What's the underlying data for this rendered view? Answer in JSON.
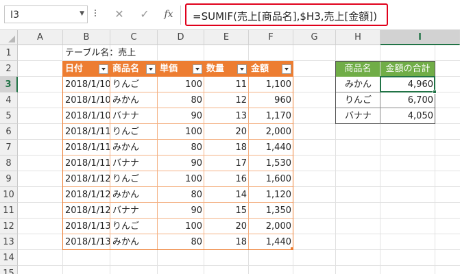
{
  "formula_bar": {
    "name_box": "I3",
    "cancel_glyph": "✕",
    "enter_glyph": "✓",
    "fx_label": "fx",
    "formula": "=SUMIF(売上[商品名],$H3,売上[金額])"
  },
  "columns": [
    "A",
    "B",
    "C",
    "D",
    "E",
    "F",
    "G",
    "H",
    "I"
  ],
  "rows": [
    "1",
    "2",
    "3",
    "4",
    "5",
    "6",
    "7",
    "8",
    "9",
    "10",
    "11",
    "12",
    "13",
    "14",
    "15"
  ],
  "selected_cell": {
    "column": "I",
    "row": "3"
  },
  "caption": "テーブル名：売上",
  "table": {
    "name": "売上",
    "headers": [
      "日付",
      "商品名",
      "単価",
      "数量",
      "金額"
    ],
    "rows": [
      [
        "2018/1/10",
        "りんご",
        "100",
        "11",
        "1,100"
      ],
      [
        "2018/1/10",
        "みかん",
        "80",
        "12",
        "960"
      ],
      [
        "2018/1/10",
        "バナナ",
        "90",
        "13",
        "1,170"
      ],
      [
        "2018/1/11",
        "りんご",
        "100",
        "20",
        "2,000"
      ],
      [
        "2018/1/11",
        "みかん",
        "80",
        "18",
        "1,440"
      ],
      [
        "2018/1/11",
        "バナナ",
        "90",
        "17",
        "1,530"
      ],
      [
        "2018/1/12",
        "りんご",
        "100",
        "16",
        "1,600"
      ],
      [
        "2018/1/12",
        "みかん",
        "80",
        "14",
        "1,120"
      ],
      [
        "2018/1/12",
        "バナナ",
        "90",
        "15",
        "1,350"
      ],
      [
        "2018/1/13",
        "りんご",
        "100",
        "20",
        "2,000"
      ],
      [
        "2018/1/13",
        "みかん",
        "80",
        "18",
        "1,440"
      ]
    ],
    "header_color": "#ed7d31",
    "band_color": "#f4b183"
  },
  "summary": {
    "headers": [
      "商品名",
      "金額の合計"
    ],
    "rows": [
      [
        "みかん",
        "4,960"
      ],
      [
        "りんご",
        "6,700"
      ],
      [
        "バナナ",
        "4,050"
      ]
    ],
    "header_color": "#70ad47"
  },
  "accent_color": "#217346",
  "highlight_color": "#e0001b"
}
